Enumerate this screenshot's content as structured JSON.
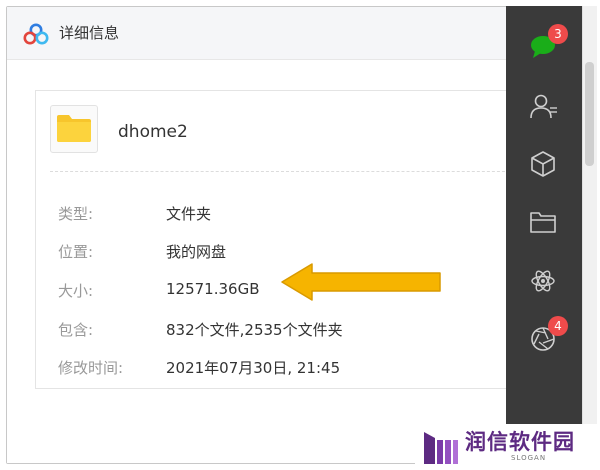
{
  "window": {
    "title": "详细信息"
  },
  "file": {
    "name": "dhome2",
    "icon": "folder-icon"
  },
  "details": [
    {
      "label": "类型:",
      "value": "文件夹"
    },
    {
      "label": "位置:",
      "value": "我的网盘"
    },
    {
      "label": "大小:",
      "value": "12571.36GB"
    },
    {
      "label": "包含:",
      "value": "832个文件,2535个文件夹"
    },
    {
      "label": "修改时间:",
      "value": "2021年07月30日, 21:45"
    }
  ],
  "sidebar": {
    "items": [
      {
        "icon": "chat-icon",
        "badge": "3"
      },
      {
        "icon": "contacts-icon",
        "badge": ""
      },
      {
        "icon": "cube-icon",
        "badge": ""
      },
      {
        "icon": "folder-icon",
        "badge": ""
      },
      {
        "icon": "atom-icon",
        "badge": ""
      },
      {
        "icon": "aperture-icon",
        "badge": "4"
      }
    ]
  },
  "watermark": {
    "text": "润信软件园",
    "slogan": "SLOGAN"
  },
  "colors": {
    "accent_yellow": "#f6b400",
    "sidebar_bg": "#3a3a3a",
    "badge_red": "#ef4b4b",
    "chat_green": "#1aad19",
    "watermark_purple": "#5d2a82"
  }
}
